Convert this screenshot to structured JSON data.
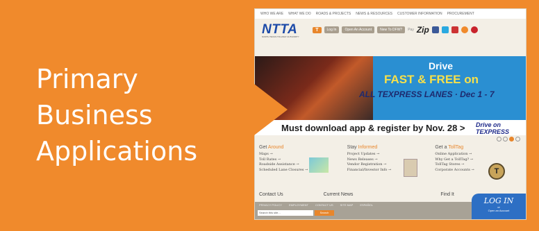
{
  "slide": {
    "title_lines": [
      "Primary",
      "Business",
      "Applications"
    ],
    "colors": {
      "background": "#f08a2c",
      "title_text": "#ffffff"
    }
  },
  "site": {
    "top_nav": [
      "WHO WE ARE",
      "WHAT WE DO",
      "ROADS & PROJECTS",
      "NEWS & RESOURCES",
      "CUSTOMER INFORMATION",
      "PROCUREMENT"
    ],
    "logo": "NTTA",
    "logo_sub": "NORTH TEXAS TOLLWAY AUTHORITY",
    "toolbar": {
      "t_badge": "T",
      "login": "Log In",
      "open_account": "Open An Account",
      "new_to_dfw": "New To DFW?",
      "pay": "Pay",
      "zip": "Zip"
    },
    "social_icons": [
      "facebook-icon",
      "twitter-icon",
      "youtube-icon",
      "rss-icon",
      "pinterest-icon"
    ],
    "hero": {
      "drive": "Drive",
      "fast_free": "FAST & FREE on",
      "lanes": "ALL TEXPRESS LANES · Dec 1 - 7"
    },
    "promo": {
      "text": "Must download app & register by Nov. 28 >",
      "drive_on": "Drive on",
      "texpress": "TEXPRESS"
    },
    "columns": [
      {
        "head_prefix": "Get ",
        "head_accent": "Around",
        "items": [
          "Maps →",
          "Toll Rates →",
          "Roadside Assistance →",
          "Scheduled Lane Closures →"
        ]
      },
      {
        "head_prefix": "Stay ",
        "head_accent": "Informed",
        "items": [
          "Project Updates →",
          "News Releases →",
          "Vendor Registration →",
          "Financial/Investor Info →"
        ]
      },
      {
        "head_prefix": "Get a ",
        "head_accent": "TollTag",
        "items": [
          "Online Application →",
          "Why Get a TollTag? →",
          "TollTag Stores →",
          "Corporate Accounts →"
        ]
      }
    ],
    "subheads": [
      "Contact Us",
      "Current News",
      "Find It"
    ],
    "footer": {
      "nav": [
        "PRIVACY POLICY",
        "EMPLOYMENT",
        "CONTACT US",
        "SITE MAP",
        "ESPAÑOL"
      ],
      "search_placeholder": "Search this site...",
      "search_button": "Search"
    },
    "login_badge": {
      "main": "LOG IN",
      "or": "or",
      "sub": "Open an Account"
    }
  }
}
